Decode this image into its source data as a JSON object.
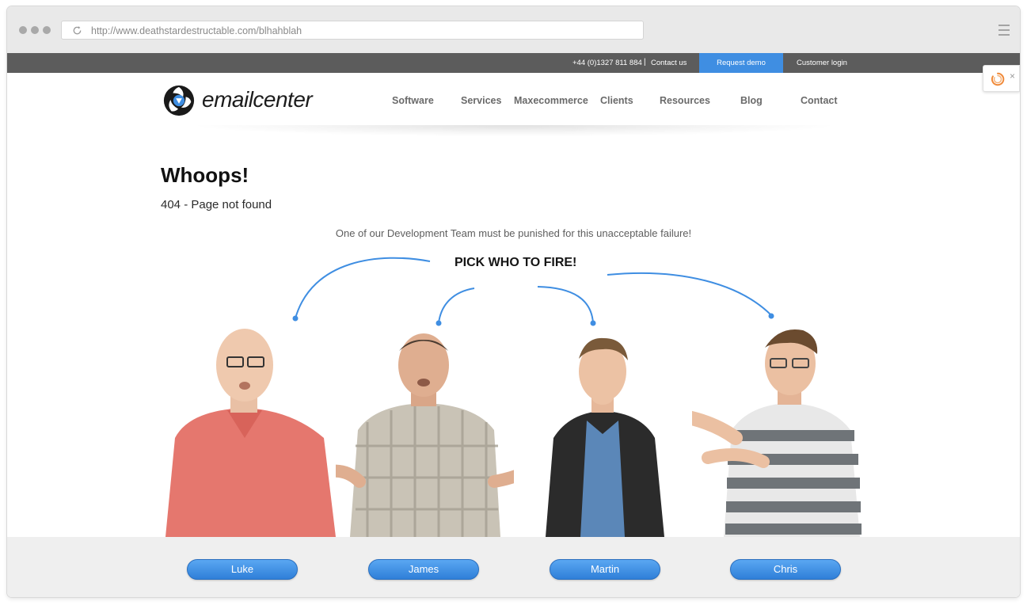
{
  "browser": {
    "url": "http://www.deathstardestructable.com/blhahblah"
  },
  "utility_bar": {
    "phone": "+44 (0)1327 811 884",
    "separator": "|",
    "contact": "Contact us",
    "demo": "Request demo",
    "login": "Customer login",
    "demo_color": "#3f8ee2",
    "background": "#5c5c5c"
  },
  "brand": {
    "name": "emailcenter"
  },
  "nav": {
    "items": [
      {
        "label": "Software"
      },
      {
        "label": "Services"
      },
      {
        "label": "Maxecommerce"
      },
      {
        "label": "Clients"
      },
      {
        "label": "Resources"
      },
      {
        "label": "Blog"
      },
      {
        "label": "Contact"
      }
    ]
  },
  "content": {
    "heading": "Whoops!",
    "subheading": "404 - Page not found",
    "intro": "One of our Development Team must be punished for this unacceptable failure!",
    "pick_prompt": "PICK WHO TO FIRE!"
  },
  "team": {
    "members": [
      {
        "name": "Luke",
        "shirt": "#e5776e"
      },
      {
        "name": "James",
        "shirt": "#c9c3b6"
      },
      {
        "name": "Martin",
        "shirt": "#2b2b2b"
      },
      {
        "name": "Chris",
        "shirt": "#6f7478"
      }
    ],
    "button_color": "#3f8ee2"
  },
  "widgets": {
    "side_widget_icon": "spinner-icon",
    "side_widget_close": "×"
  }
}
